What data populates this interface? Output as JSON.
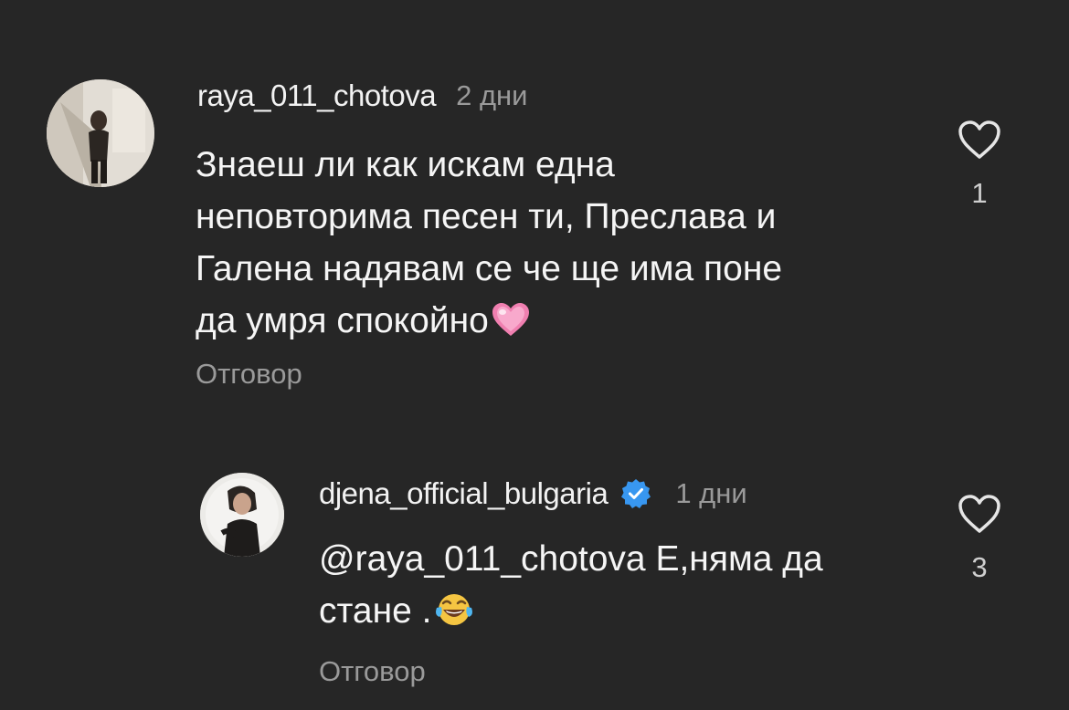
{
  "comments": [
    {
      "username": "raya_011_chotova",
      "time_ago": "2 дни",
      "text_lines": [
        "Знаеш ли как искам една",
        "неповторима песен ти, Преслава и",
        "Галена надявам се че ще има поне",
        "да умря спокойно"
      ],
      "emoji": "pink-heart",
      "reply_label": "Отговор",
      "like_count": "1",
      "verified": false
    },
    {
      "username": "djena_official_bulgaria",
      "time_ago": "1 дни",
      "text_lines": [
        "@raya_011_chotova Е,няма да",
        "стане ."
      ],
      "emoji": "tears-of-joy",
      "reply_label": "Отговор",
      "like_count": "3",
      "verified": true
    }
  ],
  "colors": {
    "background": "#262626",
    "text": "#f5f5f5",
    "muted": "#9a9a9a",
    "verified_badge": "#3897f0",
    "pink_heart": "#f48fb1"
  }
}
